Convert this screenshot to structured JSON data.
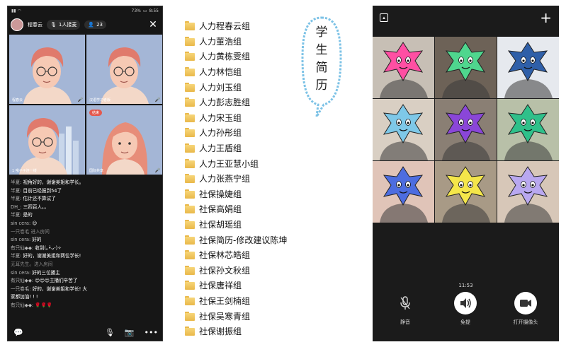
{
  "panel1": {
    "status": {
      "time": "8:55",
      "battery": "73%"
    },
    "host": {
      "name": "程春云"
    },
    "guests": {
      "count_label": "1人接麦"
    },
    "viewers": {
      "count": "23"
    },
    "tiles": [
      {
        "name": "程春云"
      },
      {
        "name": "汉语学习者版"
      },
      {
        "name": "1 哦子子连一缕"
      },
      {
        "name": "国际共享",
        "tag": "结束"
      }
    ],
    "chat": [
      {
        "user": "半夏:",
        "text": "视角好的，谢谢美姐和学长。"
      },
      {
        "user": "半夏:",
        "text": "目前已经报到54了"
      },
      {
        "user": "半夏:",
        "text": "估计还不算试了"
      },
      {
        "user": "DH_:",
        "text": "三四百人。。"
      },
      {
        "user": "半夏:",
        "text": "是的"
      },
      {
        "user": "sin cera:",
        "text": "😊"
      },
      {
        "user": "",
        "text": "一只卷毛 进入房间",
        "sys": true
      },
      {
        "user": "sin cera:",
        "text": "好的"
      },
      {
        "user": "有只仙◆◆:",
        "text": "收到(｡•̀ᴗ-)✧"
      },
      {
        "user": "半夏:",
        "text": "好的，谢谢美姐和两位学长!"
      },
      {
        "user": "",
        "text": "无耳先生。进入房间",
        "sys": true
      },
      {
        "user": "sin cera:",
        "text": "好的三位播主"
      },
      {
        "user": "有只仙◆◆:",
        "text": "😊😊😊主播们辛苦了"
      },
      {
        "user": "一只卷毛:",
        "text": "好的，谢谢美姐和学长! 大"
      },
      {
        "user": "",
        "text": "家都加油! ! !"
      },
      {
        "user": "有只仙◆◆:",
        "text": "🌹🌹🌹"
      }
    ]
  },
  "panel2": {
    "folders": [
      "人力程春云组",
      "人力董浩组",
      "人力黄栋雯组",
      "人力林恺组",
      "人力刘玉组",
      "人力彭志胜组",
      "人力宋玉组",
      "人力孙彤组",
      "人力王盾组",
      "人力王亚慧小组",
      "人力张燕宁组",
      "社保操婕组",
      "社保高娟组",
      "社保胡瑶组",
      "社保简历-修改建议陈坤",
      "社保林芯皓组",
      "社保孙文秋组",
      "社保唐祥组",
      "社保王剑楠组",
      "社保吴寒青组",
      "社保谢振组"
    ],
    "bubble_text": [
      "学",
      "生",
      "简",
      "历"
    ]
  },
  "panel3": {
    "time": "11:53",
    "controls": [
      {
        "label": "静音",
        "icon": "mic-icon"
      },
      {
        "label": "免提",
        "icon": "speaker-icon"
      },
      {
        "label": "打开摄像头",
        "icon": "camera-icon"
      }
    ],
    "tile_colors": [
      "#ff4fa3",
      "#4fd68e",
      "#2f5fa8",
      "#7ec8e8",
      "#8a46d8",
      "#2fc08a",
      "#4d6de0",
      "#f4e64a",
      "#b9a8f0"
    ]
  }
}
